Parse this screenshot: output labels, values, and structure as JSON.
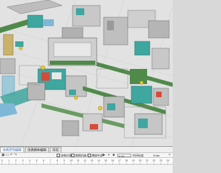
{
  "tabs": [
    {
      "label": "仿真序列编辑",
      "active": true
    },
    {
      "label": "仿真脚本编辑"
    },
    {
      "label": "日志"
    }
  ],
  "toolbar": {
    "checkbox1_label": "录制仿真",
    "checkbox2_label": "跟随机器人",
    "checkbox3_label": "播放外部",
    "time_value": "0.00",
    "time_label": "时间标度",
    "end_label": "Ends"
  },
  "ruler": {
    "ticks": [
      "0",
      "1",
      "2",
      "3",
      "4",
      "5",
      "6",
      "7",
      "8",
      "9",
      "10",
      "11",
      "12",
      "13",
      "14",
      "15",
      "16",
      "17",
      "18",
      "19",
      "20",
      "21",
      "22",
      "23",
      "24"
    ]
  },
  "colors": {
    "floor": "#e2e2e2",
    "machine_teal": "#3fa6a0",
    "conveyor_green": "#4f8a4a",
    "panel_bg": "#efefef",
    "active_tab": "#3a6bb5"
  },
  "icons": [
    "save-icon",
    "ruler-icon",
    "undo-icon",
    "redo-icon",
    "play-icon",
    "pause-icon",
    "stop-icon",
    "close-icon"
  ]
}
